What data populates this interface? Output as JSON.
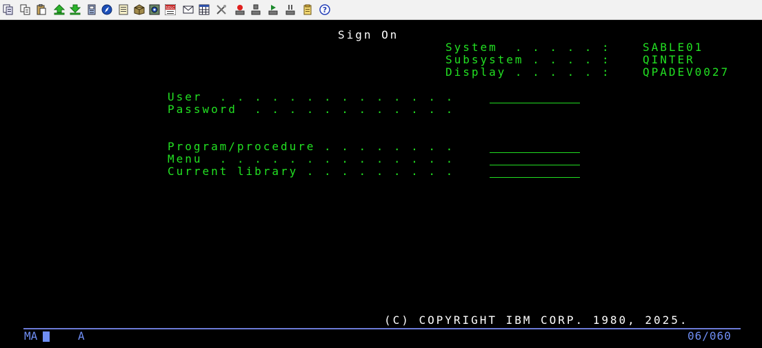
{
  "toolbar": {
    "icons": [
      "copy-screen-icon",
      "copy-icon",
      "paste-icon",
      "send-file-icon",
      "receive-file-icon",
      "macro-icon",
      "navigate-icon",
      "notes-icon",
      "package-icon",
      "settings-icon",
      "sdlc-icon",
      "mail-icon",
      "grid-icon",
      "tools-icon",
      "record-icon",
      "stop-icon",
      "play-icon",
      "pause-icon",
      "clipboard-icon",
      "help-icon"
    ]
  },
  "screen": {
    "title": "Sign On",
    "system_info": {
      "system_label": "System  . . . . . :",
      "system_value": "SABLE01",
      "subsystem_label": "Subsystem . . . . :",
      "subsystem_value": "QINTER",
      "display_label": "Display . . . . . :",
      "display_value": "QPADEV0027"
    },
    "fields": {
      "user_label": "User  . . . . . . . . . . . . . .",
      "password_label": "Password  . . . . . . . . . . . .",
      "program_label": "Program/procedure . . . . . . . .",
      "menu_label": "Menu  . . . . . . . . . . . . . .",
      "library_label": "Current library . . . . . . . . ."
    },
    "copyright": "(C) COPYRIGHT IBM CORP. 1980, 2025."
  },
  "status_bar": {
    "session_mode": "MA",
    "indicator": "A",
    "cursor_position": "06/060"
  },
  "colors": {
    "text_green": "#22e022",
    "text_white": "#ffffff",
    "status_blue": "#6f8ef4"
  }
}
